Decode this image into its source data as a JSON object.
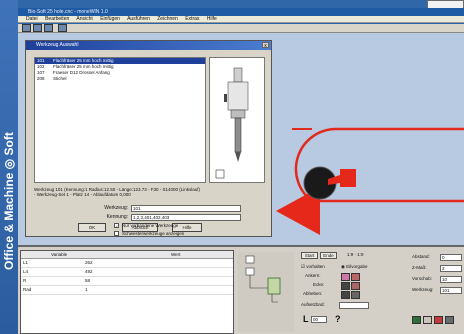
{
  "side_banner": {
    "text": "Office & Machine ◎ Soft"
  },
  "window": {
    "title": "Bio-Soft 25 hole.cnc - moneWIN 1.0"
  },
  "menu": [
    "Datei",
    "Bearbeiten",
    "Ansicht",
    "Einfügen",
    "Ausführen",
    "Zeichnen",
    "Extras",
    "Hilfe"
  ],
  "dialog": {
    "title": "Werkzeug Auswahl",
    "close_label": "x",
    "tools": [
      {
        "no": "101",
        "name": "Flachfräser 25 mm hoch mittig"
      },
      {
        "no": "102",
        "name": "Flachfräser 25 mm hoch mittig"
      },
      {
        "no": "107",
        "name": "Fraeser D12 Drossel Anfang"
      },
      {
        "no": "208",
        "name": "Stichel"
      }
    ],
    "info_line1": "Werkzeug 101 (Kennung:1     Radius:12.50 - Länge:123.73 - F30 - S14000 (Linkslauf)",
    "info_line2": "- Werkzeug-Set 1 - Platz 14 - Ablaufdatum 0,000",
    "fields": {
      "werkzeug_label": "Werkzeug:",
      "werkzeug_value": "101",
      "kennung_label": "Kennung:",
      "kennung_value": "1,2,3,401,402,403"
    },
    "checkbox1": "Nur vorhandene Werkzeuge",
    "checkbox2": "Schwesterwerkzeuge anzeigen",
    "buttons": {
      "ok": "OK",
      "abbruch": "Abbruch",
      "hilfe": "Hilfe"
    }
  },
  "variables": {
    "header_name": "Variable",
    "header_value": "Wert",
    "rows": [
      {
        "name": "L1",
        "value": "262"
      },
      {
        "name": "L4",
        "value": "492"
      },
      {
        "name": "R",
        "value": "58"
      },
      {
        "name": "Rad",
        "value": "1"
      }
    ]
  },
  "props": {
    "start": "Start",
    "ende": "Ende",
    "range": "1:9 · 1:9",
    "chk1": "vorhalten",
    "chk2": "Eilvorgabe",
    "ankern": "Ankern:",
    "ecke": "Ecke:",
    "abheben": "Abheben:",
    "aufsetz": "Aufsetzbnd:",
    "L_value": "00"
  },
  "right_fields": {
    "abstand_label": "Abstand:",
    "abstand_value": "0",
    "zmass_label": "Z-Maß:",
    "zmass_value": "2",
    "vorschub_label": "Vorschub:",
    "vorschub_value": "10",
    "werkzeug_label": "Werkzeug:",
    "werkzeug_value": "101"
  },
  "colors": {
    "accent_red": "#e02a1e",
    "canvas": "#b8c9e2",
    "brand_blue": "#2b63a9"
  }
}
